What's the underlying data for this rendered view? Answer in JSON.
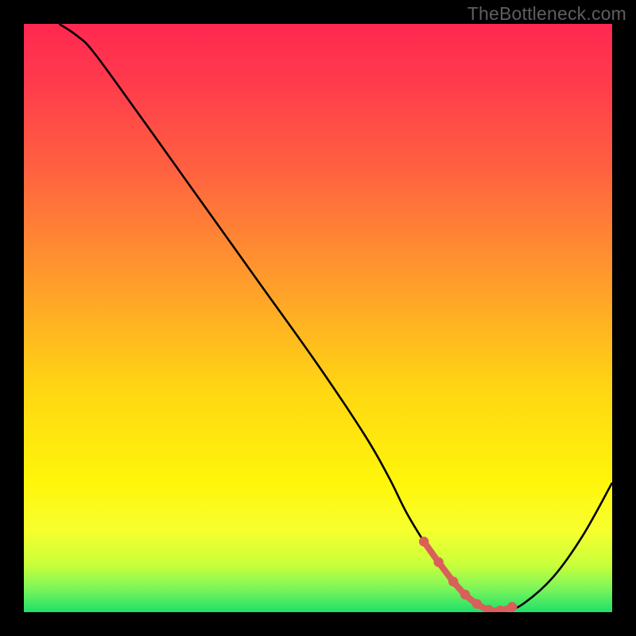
{
  "watermark": "TheBottleneck.com",
  "chart_data": {
    "type": "line",
    "title": "",
    "xlabel": "",
    "ylabel": "",
    "xlim": [
      0,
      100
    ],
    "ylim": [
      0,
      100
    ],
    "grid": false,
    "legend": false,
    "series": [
      {
        "name": "curve",
        "color": "#000000",
        "x": [
          6,
          9,
          12,
          20,
          30,
          40,
          50,
          58,
          62,
          65,
          68,
          72,
          76,
          79,
          82,
          85,
          90,
          95,
          100
        ],
        "y": [
          100,
          98,
          95,
          84,
          70,
          56,
          42,
          30,
          23,
          17,
          12,
          6,
          2,
          0.4,
          0.3,
          1.5,
          6,
          13,
          22
        ]
      }
    ],
    "highlight_segment": {
      "color": "#d9605a",
      "x": [
        68,
        70.5,
        73,
        75,
        77,
        79,
        81,
        83
      ],
      "y": [
        12,
        8.5,
        5.2,
        3,
        1.4,
        0.4,
        0.3,
        0.9
      ]
    },
    "gradient_stops": [
      {
        "pct": 0,
        "color": "#ff2850"
      },
      {
        "pct": 10,
        "color": "#ff3b4c"
      },
      {
        "pct": 25,
        "color": "#ff6240"
      },
      {
        "pct": 45,
        "color": "#ffa02a"
      },
      {
        "pct": 62,
        "color": "#ffd613"
      },
      {
        "pct": 78,
        "color": "#fff60a"
      },
      {
        "pct": 86,
        "color": "#f7ff2e"
      },
      {
        "pct": 92,
        "color": "#c8ff3a"
      },
      {
        "pct": 96,
        "color": "#7cf55a"
      },
      {
        "pct": 100,
        "color": "#1ee06a"
      }
    ]
  }
}
